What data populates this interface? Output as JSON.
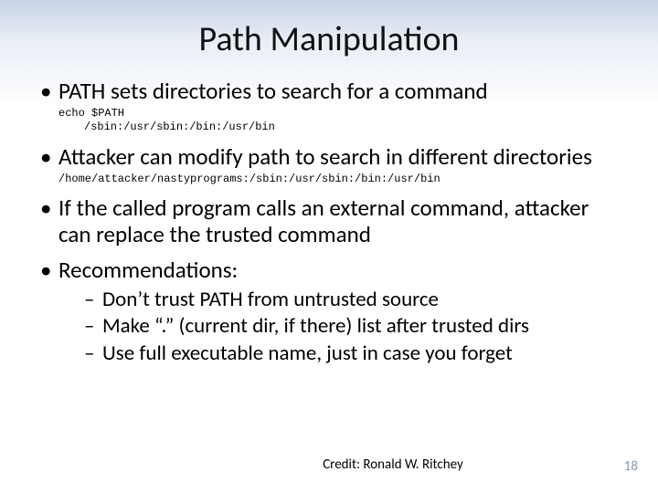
{
  "title": "Path Manipulation",
  "bullets": {
    "b1": "PATH sets directories to search for a command",
    "b1_code_line1": "echo $PATH",
    "b1_code_line2": "/sbin:/usr/sbin:/bin:/usr/bin",
    "b2": "Attacker can modify path to search in different directories",
    "b2_code": "/home/attacker/nastyprograms:/sbin:/usr/sbin:/bin:/usr/bin",
    "b3": "If the called program calls an external command, attacker can replace the trusted command",
    "b4": "Recommendations:",
    "sub1": "Don’t trust PATH from untrusted source",
    "sub2": "Make “.” (current dir, if there) list after trusted dirs",
    "sub3": "Use full executable name, just in case you forget"
  },
  "credit": "Credit: Ronald W. Ritchey",
  "page_number": "18"
}
